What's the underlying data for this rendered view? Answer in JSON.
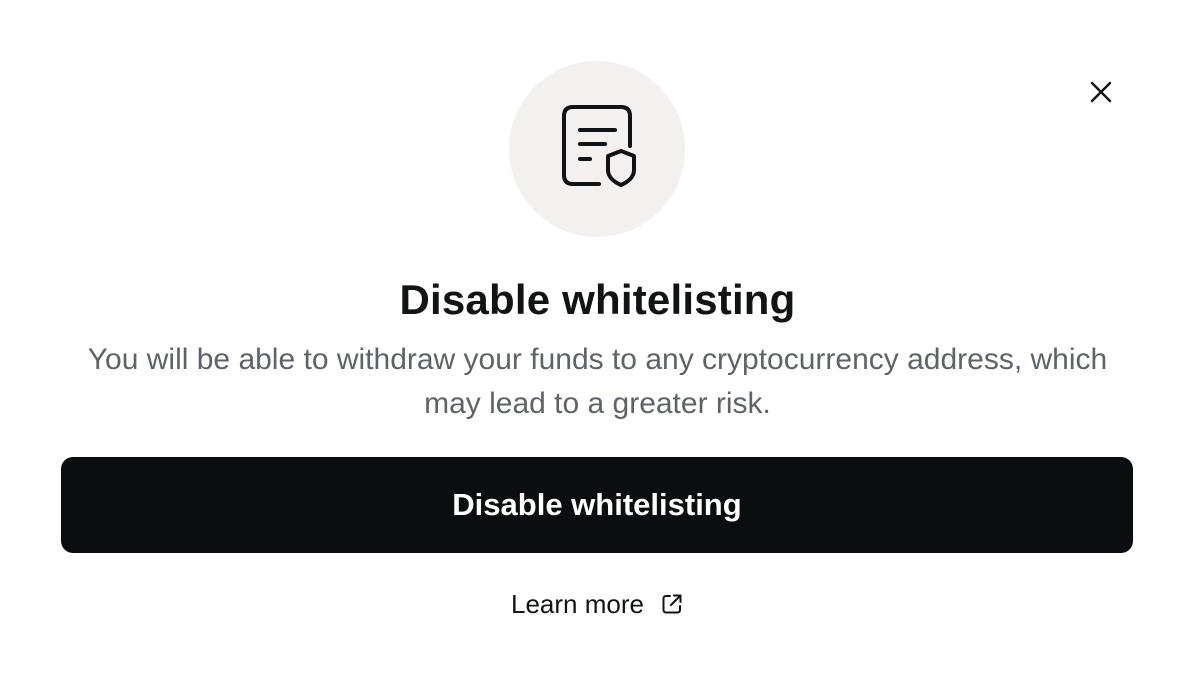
{
  "dialog": {
    "icon": "document-shield-icon",
    "title": "Disable whitelisting",
    "description": "You will be able to withdraw your funds to any cryptocurrency address, which may lead to a greater risk.",
    "primary_button_label": "Disable whitelisting",
    "learn_more_label": "Learn more",
    "learn_more_icon": "external-link-icon",
    "close_icon": "close-icon"
  },
  "colors": {
    "background": "#ffffff",
    "icon_circle": "#f2f1ef",
    "primary_button": "#0b0e11",
    "title_text": "#111315",
    "description_text": "#5f6369"
  }
}
